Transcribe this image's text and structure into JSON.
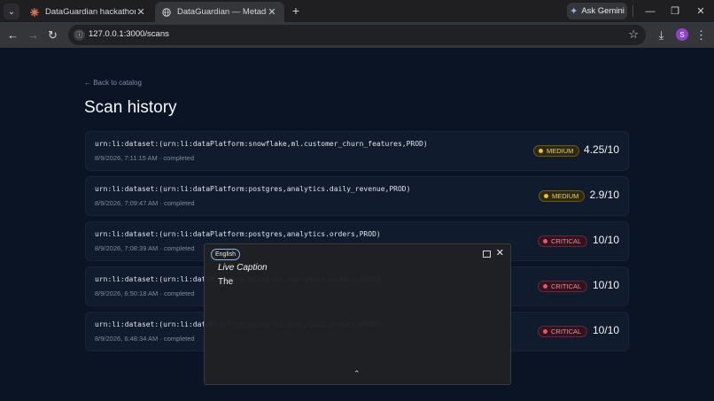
{
  "browser": {
    "tabs": [
      {
        "title": "DataGuardian hackathon projec",
        "favicon": "claude-burst-icon",
        "active": false
      },
      {
        "title": "DataGuardian — Metadata-Aw",
        "favicon": "globe-icon",
        "active": true
      }
    ],
    "new_tab_symbol": "+",
    "gemini_label": "Ask Gemini",
    "url": "127.0.0.1:3000/scans",
    "profile_initial": "S"
  },
  "page": {
    "back_label": "← Back to catalog",
    "title": "Scan history",
    "scans": [
      {
        "urn": "urn:li:dataset:(urn:li:dataPlatform:snowflake,ml.customer_churn_features,PROD)",
        "meta": "8/9/2026, 7:11:15 AM · completed",
        "severity": "MEDIUM",
        "score": "4.25/10"
      },
      {
        "urn": "urn:li:dataset:(urn:li:dataPlatform:postgres,analytics.daily_revenue,PROD)",
        "meta": "8/9/2026, 7:09:47 AM · completed",
        "severity": "MEDIUM",
        "score": "2.9/10"
      },
      {
        "urn": "urn:li:dataset:(urn:li:dataPlatform:postgres,analytics.orders,PROD)",
        "meta": "8/9/2026, 7:08:39 AM · completed",
        "severity": "CRITICAL",
        "score": "10/10"
      },
      {
        "urn": "urn:li:dataset:(urn:li:dataPlatform:postgres,analytics.orders,PROD)",
        "meta": "8/9/2026, 6:50:18 AM · completed",
        "severity": "CRITICAL",
        "score": "10/10"
      },
      {
        "urn": "urn:li:dataset:(urn:li:dataPlatform:postgres,analytics.orders,PROD)",
        "meta": "8/9/2026, 6:48:34 AM · completed",
        "severity": "CRITICAL",
        "score": "10/10"
      }
    ]
  },
  "live_caption": {
    "language": "English",
    "title": "Live Caption",
    "text": "The"
  },
  "colors": {
    "page_background": "#0b1424",
    "row_background": "#101b2d",
    "medium": "#e5c14a",
    "critical": "#ef5466"
  }
}
